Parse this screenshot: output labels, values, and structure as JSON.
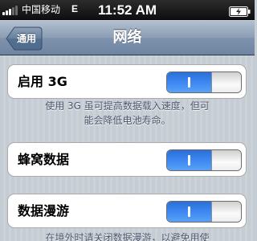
{
  "status_bar": {
    "carrier": "中国移动",
    "network": "E",
    "time": "11:52 AM",
    "battery_icon": "battery-charging-icon",
    "signal_icon": "signal-strength-icon"
  },
  "nav": {
    "back_label": "通用",
    "title": "网络"
  },
  "settings": [
    {
      "label": "启用 3G",
      "toggle_label": "I",
      "state": "on"
    },
    {
      "label": "蜂窝数据",
      "toggle_label": "I",
      "state": "on"
    },
    {
      "label": "数据漫游",
      "toggle_label": "I",
      "state": "on"
    }
  ],
  "notes": {
    "enable_3g_line1": "使用 3G 虽可提高数据载入速度，但可",
    "enable_3g_line2": "能会降低电池寿命。",
    "roaming_line1": "在境外时请关闭数据漫游，以避免用使"
  },
  "colors": {
    "toggle_on": "#3f8bf3",
    "nav_bar": "#8b9db4",
    "page_bg": "#c5ccd4"
  }
}
